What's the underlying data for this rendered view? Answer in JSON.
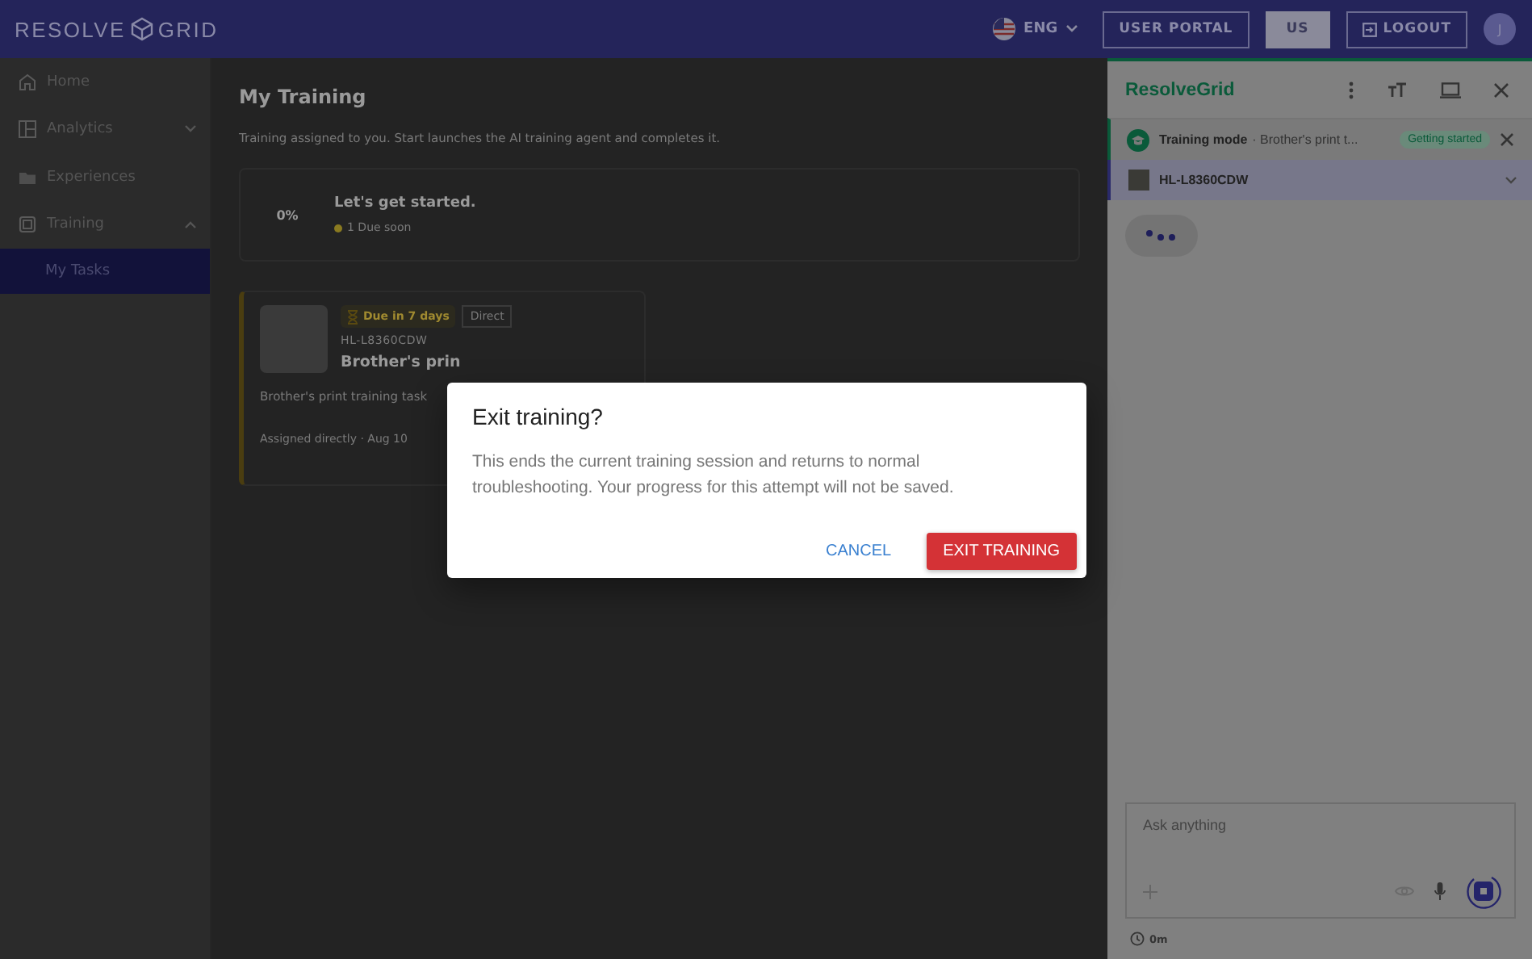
{
  "header": {
    "logo": [
      "RESOLVE",
      "GRID"
    ],
    "language": "ENG",
    "buttons": [
      {
        "label": "USER PORTAL",
        "kind": "outline"
      },
      {
        "label": "US",
        "kind": "filled"
      },
      {
        "label": "LOGOUT",
        "kind": "logout"
      }
    ],
    "avatar": "J"
  },
  "sidebar": {
    "items": [
      {
        "label": "Home",
        "kind": "home",
        "selected": false
      },
      {
        "label": "Analytics",
        "kind": "analytics",
        "selected": false,
        "expanded": false
      },
      {
        "label": "Experiences",
        "kind": "folder",
        "selected": false
      },
      {
        "label": "Training",
        "kind": "training",
        "selected": false,
        "expanded": true,
        "children": [
          {
            "label": "My Tasks",
            "selected": true
          }
        ]
      }
    ]
  },
  "main": {
    "title": "My Training",
    "subtitle": "Training assigned to you. Start launches the AI training agent and completes it.",
    "progress_card": {
      "percent": "0%",
      "heading": "Let's get started.",
      "status": "1 Due soon"
    },
    "task_card": {
      "due": "Due in 7 days",
      "tag": "Direct",
      "model": "HL-L8360CDW",
      "title": "Brother's prin",
      "description": "Brother's print training task",
      "assigned": "Assigned directly · Aug 10"
    }
  },
  "assistant": {
    "title": "ResolveGrid",
    "banner": {
      "label": "Training mode",
      "detail": "· Brother's print t...",
      "badge": "Getting started"
    },
    "device": "HL-L8360CDW",
    "input": {
      "placeholder": "Ask anything"
    },
    "timer": "0m"
  },
  "dialog": {
    "title": "Exit training?",
    "message": "This ends the current training session and returns to normal troubleshooting. Your progress for this attempt will not be saved.",
    "buttons": [
      {
        "label": "CANCEL",
        "kind": "text"
      },
      {
        "label": "EXIT TRAINING",
        "kind": "danger"
      }
    ]
  }
}
